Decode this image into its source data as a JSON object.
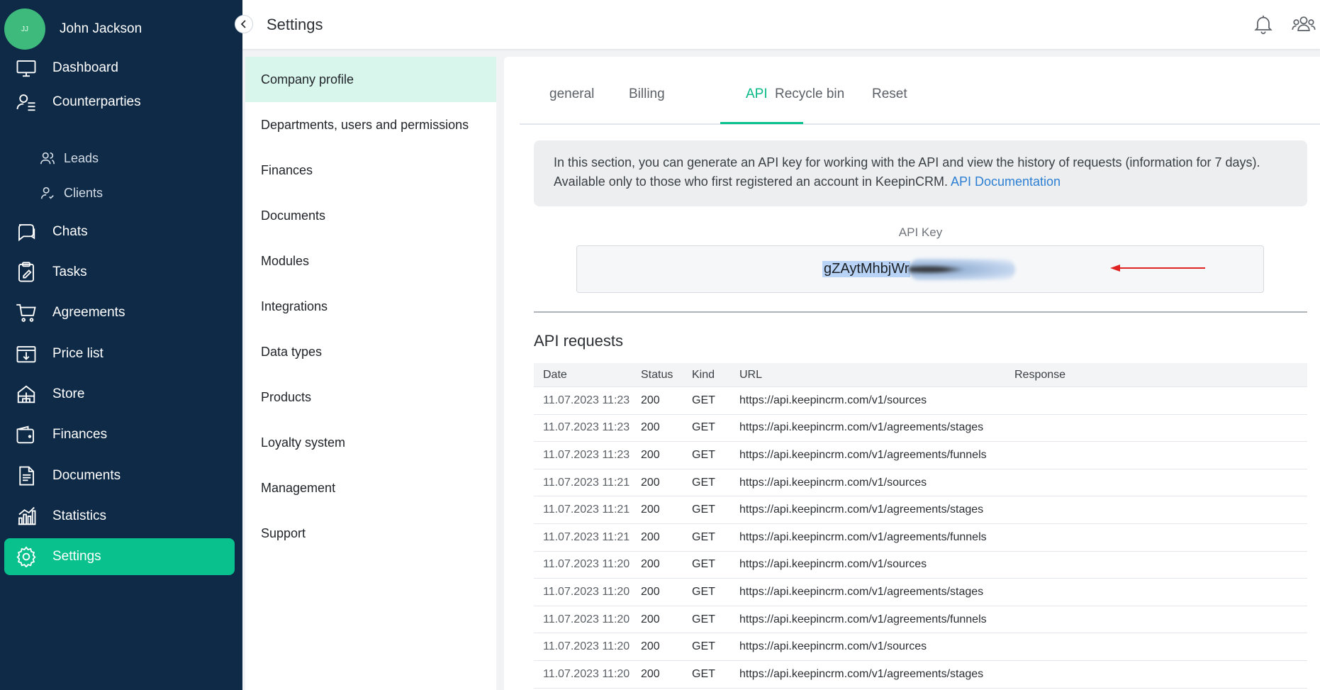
{
  "user": {
    "initials": "JJ",
    "name": "John Jackson"
  },
  "nav": {
    "dashboard": "Dashboard",
    "counterparties": "Counterparties",
    "leads": "Leads",
    "clients": "Clients",
    "chats": "Chats",
    "tasks": "Tasks",
    "agreements": "Agreements",
    "price_list": "Price list",
    "store": "Store",
    "finances": "Finances",
    "documents": "Documents",
    "statistics": "Statistics",
    "settings": "Settings"
  },
  "header": {
    "title": "Settings"
  },
  "submenu": [
    "Company profile",
    "Departments, users and permissions",
    "Finances",
    "Documents",
    "Modules",
    "Integrations",
    "Data types",
    "Products",
    "Loyalty system",
    "Management",
    "Support"
  ],
  "tabs": [
    "general",
    "Billing",
    "API",
    "Recycle bin",
    "Reset"
  ],
  "info": {
    "line1": "In this section, you can generate an API key for working with the API and view the history of requests (information for 7 days).",
    "line2": "Available only to those who first registered an account in KeepinCRM. ",
    "link": "API Documentation"
  },
  "api_key": {
    "label": "API Key",
    "visible_value": "gZAytMhbjWr"
  },
  "requests": {
    "title": "API requests",
    "columns": [
      "Date",
      "Status",
      "Kind",
      "URL",
      "Response"
    ],
    "rows": [
      [
        "11.07.2023 11:23",
        "200",
        "GET",
        "https://api.keepincrm.com/v1/sources",
        ""
      ],
      [
        "11.07.2023 11:23",
        "200",
        "GET",
        "https://api.keepincrm.com/v1/agreements/stages",
        ""
      ],
      [
        "11.07.2023 11:23",
        "200",
        "GET",
        "https://api.keepincrm.com/v1/agreements/funnels",
        ""
      ],
      [
        "11.07.2023 11:21",
        "200",
        "GET",
        "https://api.keepincrm.com/v1/sources",
        ""
      ],
      [
        "11.07.2023 11:21",
        "200",
        "GET",
        "https://api.keepincrm.com/v1/agreements/stages",
        ""
      ],
      [
        "11.07.2023 11:21",
        "200",
        "GET",
        "https://api.keepincrm.com/v1/agreements/funnels",
        ""
      ],
      [
        "11.07.2023 11:20",
        "200",
        "GET",
        "https://api.keepincrm.com/v1/sources",
        ""
      ],
      [
        "11.07.2023 11:20",
        "200",
        "GET",
        "https://api.keepincrm.com/v1/agreements/stages",
        ""
      ],
      [
        "11.07.2023 11:20",
        "200",
        "GET",
        "https://api.keepincrm.com/v1/agreements/funnels",
        ""
      ],
      [
        "11.07.2023 11:20",
        "200",
        "GET",
        "https://api.keepincrm.com/v1/sources",
        ""
      ],
      [
        "11.07.2023 11:20",
        "200",
        "GET",
        "https://api.keepincrm.com/v1/agreements/stages",
        ""
      ]
    ]
  },
  "colors": {
    "sidebar_bg": "#0e2a47",
    "accent": "#08c18c",
    "submenu_active": "#d8f6ec",
    "link": "#2d7fd3",
    "arrow": "#e02424"
  }
}
